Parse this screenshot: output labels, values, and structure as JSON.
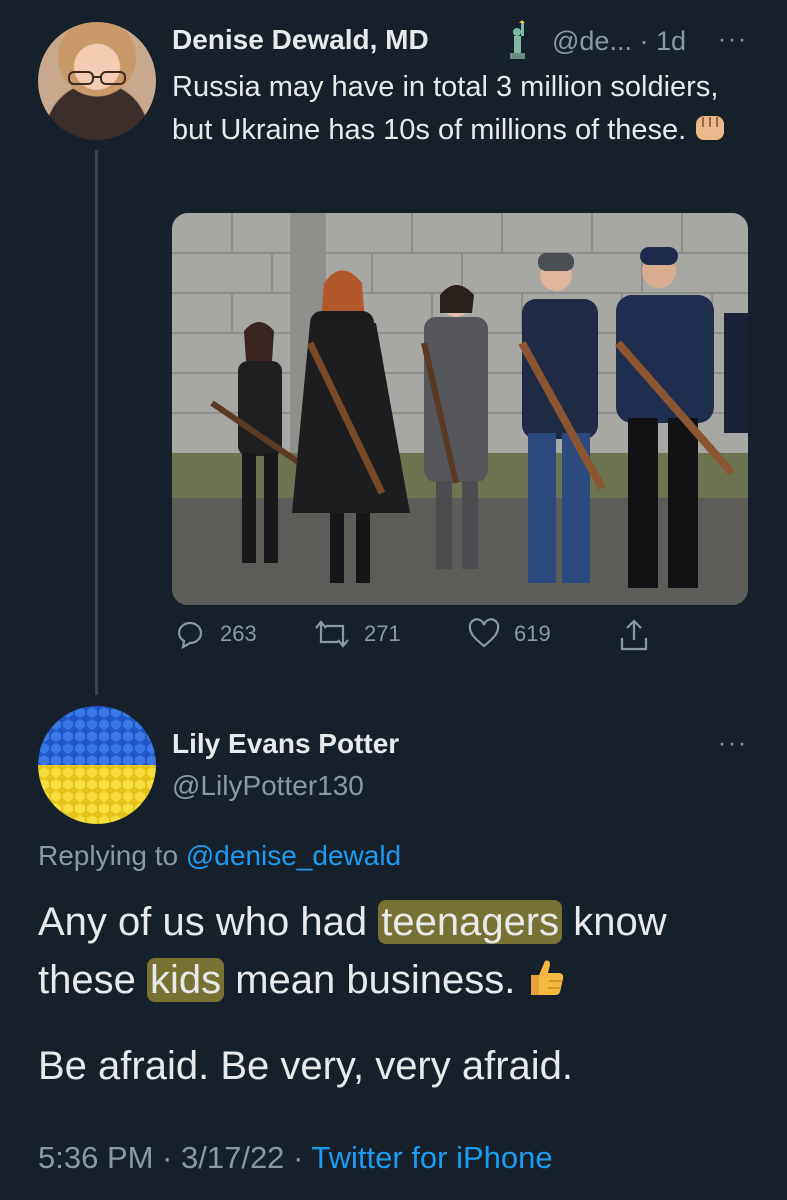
{
  "tweet": {
    "author_name": "Denise Dewald, MD",
    "handle": "@de...",
    "time": "· 1d",
    "more": "···",
    "text": "Russia may have in total 3 million soldiers, but Ukraine has 10s of millions of these.",
    "actions": {
      "replies": "263",
      "retweets": "271",
      "likes": "619"
    }
  },
  "reply": {
    "author_name": "Lily Evans Potter",
    "handle": "@LilyPotter130",
    "more": "···",
    "replying_prefix": "Replying to ",
    "replying_mention": "@denise_dewald",
    "line1_a": "Any of us who had ",
    "line1_hl": "teenagers",
    "line1_b": " know",
    "line2_a": "these ",
    "line2_hl": "kids",
    "line2_b": " mean business.",
    "para2": "Be afraid. Be very, very afraid.",
    "time": "5:36 PM · 3/17/22 · ",
    "source": "Twitter for iPhone"
  },
  "colors": {
    "background": "#15202b",
    "muted": "#8b98a5",
    "link": "#1d9bf0",
    "highlight": "#c8b43c"
  },
  "icons": [
    "statue-of-liberty-icon",
    "raised-fist-icon",
    "reply-icon",
    "retweet-icon",
    "like-icon",
    "share-icon",
    "thumbs-up-icon",
    "more-icon"
  ]
}
